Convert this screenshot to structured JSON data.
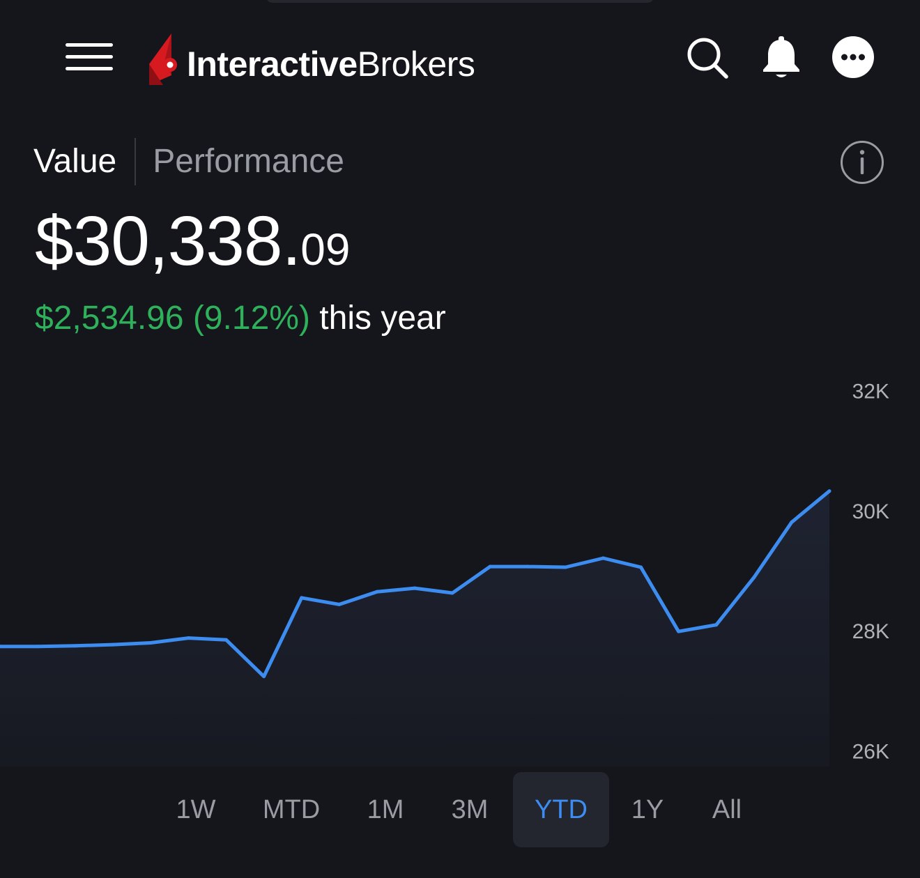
{
  "header": {
    "logo_bold": "Interactive",
    "logo_light": "Brokers"
  },
  "tabs": [
    {
      "label": "Value",
      "active": true
    },
    {
      "label": "Performance",
      "active": false
    }
  ],
  "portfolio": {
    "value_main": "$30,338.",
    "value_cents": "09",
    "change_amount": "$2,534.96 (9.12%)",
    "change_period": "this year"
  },
  "colors": {
    "background": "#15161c",
    "positive": "#2fb15b",
    "line": "#3d8cf0",
    "brand_red": "#d71920"
  },
  "chart_data": {
    "type": "line",
    "title": "",
    "xlabel": "",
    "ylabel": "",
    "ylim": [
      25750,
      32250
    ],
    "yticks": [
      32000,
      30000,
      28000,
      26000
    ],
    "ytick_labels": [
      "32K",
      "30K",
      "28K",
      "26K"
    ],
    "grid": false,
    "series": [
      {
        "values": [
          27750,
          27750,
          27760,
          27780,
          27810,
          27890,
          27860,
          27250,
          28560,
          28450,
          28660,
          28720,
          28640,
          29080,
          29080,
          29070,
          29220,
          29070,
          28000,
          28110,
          28900,
          29820,
          30338
        ]
      }
    ]
  },
  "range_selector": {
    "options": [
      "1W",
      "MTD",
      "1M",
      "3M",
      "YTD",
      "1Y",
      "All"
    ],
    "selected": "YTD"
  }
}
